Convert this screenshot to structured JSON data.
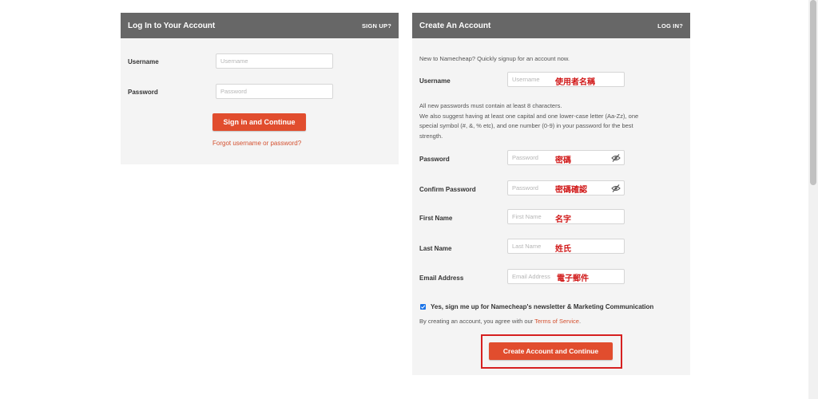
{
  "login": {
    "title": "Log In to Your Account",
    "signup_link": "SIGN UP?",
    "username_label": "Username",
    "username_placeholder": "Username",
    "password_label": "Password",
    "password_placeholder": "Password",
    "submit_label": "Sign in and Continue",
    "forgot_link": "Forgot username or password?"
  },
  "signup": {
    "title": "Create An Account",
    "login_link": "LOG IN?",
    "intro": "New to Namecheap? Quickly signup for an account now.",
    "username_label": "Username",
    "username_placeholder": "Username",
    "username_annotation": "使用者名稱",
    "password_rules": "All new passwords must contain at least 8 characters.",
    "password_suggestion": "We also suggest having at least one capital and one lower-case letter (Aa-Zz), one special symbol (#, &, % etc), and one number (0-9) in your password for the best strength.",
    "password_label": "Password",
    "password_placeholder": "Password",
    "password_annotation": "密碼",
    "confirm_label": "Confirm Password",
    "confirm_placeholder": "Password",
    "confirm_annotation": "密碼確認",
    "first_name_label": "First Name",
    "first_name_placeholder": "First Name",
    "first_name_annotation": "名字",
    "last_name_label": "Last Name",
    "last_name_placeholder": "Last Name",
    "last_name_annotation": "姓氏",
    "email_label": "Email Address",
    "email_placeholder": "Email Address",
    "email_annotation": "電子郵件",
    "newsletter_label": "Yes, sign me up for Namecheap's newsletter & Marketing Communication",
    "newsletter_checked": true,
    "terms_prefix": "By creating an account, you agree with our ",
    "terms_link": "Terms of Service",
    "terms_suffix": ".",
    "submit_label": "Create Account and Continue"
  },
  "icons": {
    "eye_off": "eye-off-icon",
    "check": "check-icon"
  },
  "colors": {
    "header_bg": "#676767",
    "panel_bg": "#f4f4f4",
    "accent": "#e14d2e",
    "annotation": "#d01616",
    "highlight": "#d62020"
  }
}
